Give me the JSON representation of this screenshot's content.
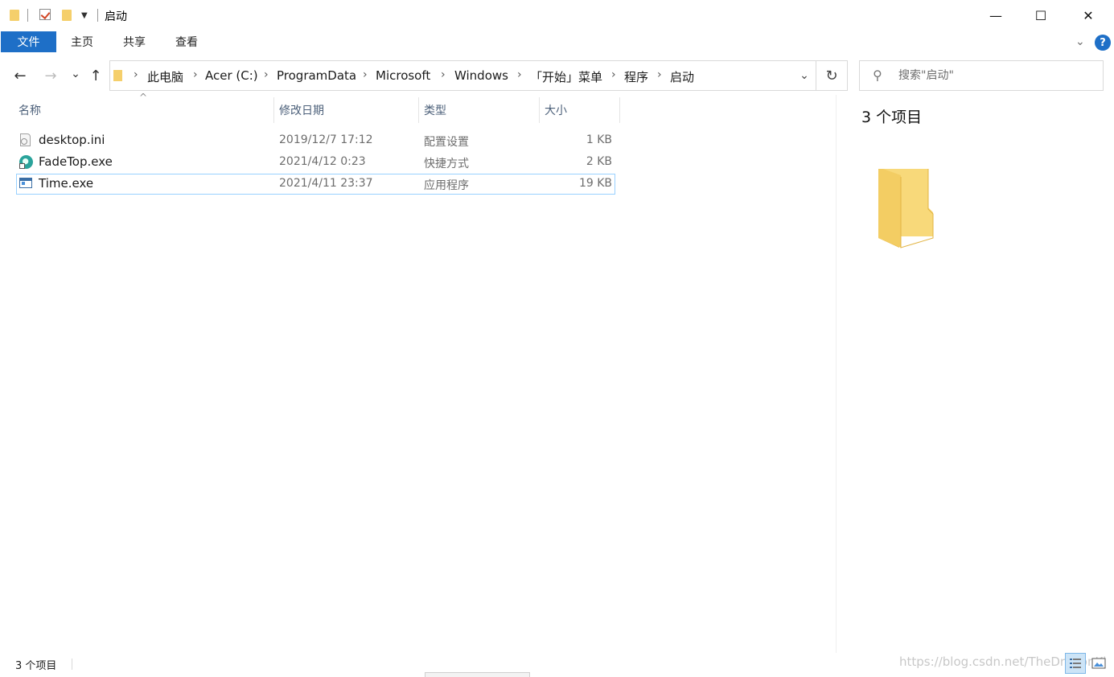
{
  "window": {
    "title": "启动",
    "minimize_glyph": "—",
    "maximize_glyph": "☐",
    "close_glyph": "✕"
  },
  "ribbon": {
    "tabs": [
      {
        "label": "文件",
        "active": true
      },
      {
        "label": "主页"
      },
      {
        "label": "共享"
      },
      {
        "label": "查看"
      }
    ],
    "help_glyph": "?"
  },
  "nav": {
    "back_glyph": "←",
    "forward_glyph": "→",
    "recent_glyph": "⌄",
    "up_glyph": "↑",
    "refresh_glyph": "↻",
    "dropdown_glyph": "⌄",
    "breadcrumb": [
      "此电脑",
      "Acer (C:)",
      "ProgramData",
      "Microsoft",
      "Windows",
      "「开始」菜单",
      "程序",
      "启动"
    ]
  },
  "search": {
    "placeholder": "搜索\"启动\""
  },
  "columns": {
    "name": "名称",
    "date": "修改日期",
    "type": "类型",
    "size": "大小"
  },
  "files": [
    {
      "name": "desktop.ini",
      "date": "2019/12/7 17:12",
      "type": "配置设置",
      "size": "1 KB",
      "icon": "settings-file-icon"
    },
    {
      "name": "FadeTop.exe",
      "date": "2021/4/12 0:23",
      "type": "快捷方式",
      "size": "2 KB",
      "icon": "shortcut-app-icon"
    },
    {
      "name": "Time.exe",
      "date": "2021/4/11 23:37",
      "type": "应用程序",
      "size": "19 KB",
      "icon": "application-icon",
      "selected": true
    }
  ],
  "preview": {
    "item_count": "3 个项目"
  },
  "status": {
    "item_count": "3 个项目"
  },
  "watermark": "https://blog.csdn.net/TheDragonKi",
  "colors": {
    "accent": "#1e6fc7",
    "selection_border": "#99d1ff",
    "folder": "#f5cf6b"
  }
}
